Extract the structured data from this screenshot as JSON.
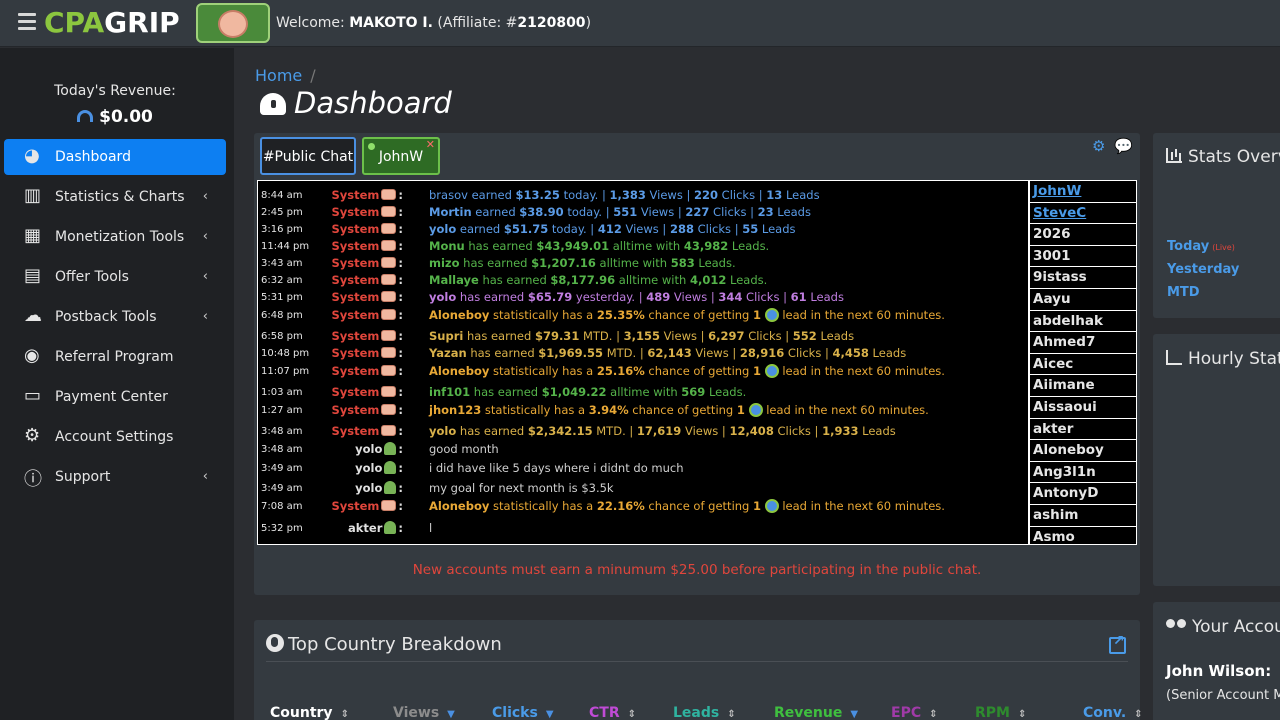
{
  "header": {
    "logo_cpa": "CPA",
    "logo_grip": "GRIP",
    "welcome_prefix": "Welcome: ",
    "user_name": "MAKOTO I.",
    "affiliate_prefix": " (Affiliate: #",
    "affiliate_id": "2120800",
    "affiliate_suffix": ")"
  },
  "sidebar": {
    "revenue_label": "Today's Revenue:",
    "revenue_value": "$0.00",
    "items": [
      {
        "label": "Dashboard",
        "icon": "gauge-icon",
        "active": true,
        "chevron": false
      },
      {
        "label": "Statistics & Charts",
        "icon": "bar-chart-icon",
        "chevron": true
      },
      {
        "label": "Monetization Tools",
        "icon": "grid-icon",
        "chevron": true
      },
      {
        "label": "Offer Tools",
        "icon": "clipboard-icon",
        "chevron": true
      },
      {
        "label": "Postback Tools",
        "icon": "cloud-icon",
        "chevron": true
      },
      {
        "label": "Referral Program",
        "icon": "coins-icon",
        "chevron": false
      },
      {
        "label": "Payment Center",
        "icon": "money-bill-icon",
        "chevron": false
      },
      {
        "label": "Account Settings",
        "icon": "gear-icon",
        "chevron": false
      },
      {
        "label": "Support",
        "icon": "info-icon",
        "chevron": true
      }
    ],
    "chevron_glyph": "‹"
  },
  "breadcrumb": {
    "home": "Home",
    "sep": "/"
  },
  "page_title": "Dashboard",
  "chat": {
    "tabs": {
      "public": "#Public Chat",
      "john": "JohnW"
    },
    "notice": "New accounts must earn a minumum $25.00 before participating in the public chat.",
    "messages": [
      {
        "time": "8:44 am",
        "user": "System",
        "parts": [
          [
            "blue",
            "brasov"
          ],
          [
            "blue",
            " earned "
          ],
          [
            "bblue",
            "$13.25"
          ],
          [
            "blue",
            " today. | "
          ],
          [
            "bblue",
            "1,383"
          ],
          [
            "blue",
            " Views | "
          ],
          [
            "bblue",
            "220"
          ],
          [
            "blue",
            " Clicks | "
          ],
          [
            "bblue",
            "13"
          ],
          [
            "blue",
            " Leads"
          ]
        ]
      },
      {
        "time": "2:45 pm",
        "user": "System",
        "parts": [
          [
            "bblue",
            "Mortin"
          ],
          [
            "blue",
            " earned "
          ],
          [
            "bblue",
            "$38.90"
          ],
          [
            "blue",
            " today. | "
          ],
          [
            "bblue",
            "551"
          ],
          [
            "blue",
            " Views | "
          ],
          [
            "bblue",
            "227"
          ],
          [
            "blue",
            " Clicks | "
          ],
          [
            "bblue",
            "23"
          ],
          [
            "blue",
            " Leads"
          ]
        ]
      },
      {
        "time": "3:16 pm",
        "user": "System",
        "parts": [
          [
            "bblue",
            "yolo"
          ],
          [
            "blue",
            " earned "
          ],
          [
            "bblue",
            "$51.75"
          ],
          [
            "blue",
            " today. | "
          ],
          [
            "bblue",
            "412"
          ],
          [
            "blue",
            " Views | "
          ],
          [
            "bblue",
            "288"
          ],
          [
            "blue",
            " Clicks | "
          ],
          [
            "bblue",
            "55"
          ],
          [
            "blue",
            " Leads"
          ]
        ]
      },
      {
        "time": "11:44 pm",
        "user": "System",
        "parts": [
          [
            "bgreen",
            "Monu"
          ],
          [
            "green",
            " has earned "
          ],
          [
            "bgreen",
            "$43,949.01"
          ],
          [
            "green",
            " alltime with "
          ],
          [
            "bgreen",
            "43,982"
          ],
          [
            "green",
            " Leads."
          ]
        ]
      },
      {
        "time": "3:43 am",
        "user": "System",
        "parts": [
          [
            "bgreen",
            "mizo"
          ],
          [
            "green",
            " has earned "
          ],
          [
            "bgreen",
            "$1,207.16"
          ],
          [
            "green",
            " alltime with "
          ],
          [
            "bgreen",
            "583"
          ],
          [
            "green",
            " Leads."
          ]
        ]
      },
      {
        "time": "6:32 am",
        "user": "System",
        "parts": [
          [
            "bgreen",
            "Mallaye"
          ],
          [
            "green",
            " has earned "
          ],
          [
            "bgreen",
            "$8,177.96"
          ],
          [
            "green",
            " alltime with "
          ],
          [
            "bgreen",
            "4,012"
          ],
          [
            "green",
            " Leads."
          ]
        ]
      },
      {
        "time": "5:31 pm",
        "user": "System",
        "parts": [
          [
            "bpurple",
            "yolo"
          ],
          [
            "purple",
            " has earned "
          ],
          [
            "bpurple",
            "$65.79"
          ],
          [
            "purple",
            " yesterday. | "
          ],
          [
            "bpurple",
            "489"
          ],
          [
            "purple",
            " Views | "
          ],
          [
            "bpurple",
            "344"
          ],
          [
            "purple",
            " Clicks | "
          ],
          [
            "bpurple",
            "61"
          ],
          [
            "purple",
            " Leads"
          ]
        ]
      },
      {
        "time": "6:48 pm",
        "user": "System",
        "parts": [
          [
            "bgold",
            "Aloneboy"
          ],
          [
            "gold",
            " statistically has a "
          ],
          [
            "bgold",
            "25.35%"
          ],
          [
            "gold",
            " chance of getting "
          ],
          [
            "bgold",
            "1"
          ],
          [
            "globe",
            ""
          ],
          [
            "gold",
            " lead in the next 60 minutes."
          ]
        ]
      },
      {
        "time": "6:58 pm",
        "user": "System",
        "parts": [
          [
            "btan",
            "Supri"
          ],
          [
            "tan",
            " has earned "
          ],
          [
            "btan",
            "$79.31"
          ],
          [
            "tan",
            " MTD. | "
          ],
          [
            "btan",
            "3,155"
          ],
          [
            "tan",
            " Views | "
          ],
          [
            "btan",
            "6,297"
          ],
          [
            "tan",
            " Clicks | "
          ],
          [
            "btan",
            "552"
          ],
          [
            "tan",
            " Leads"
          ]
        ]
      },
      {
        "time": "10:48 pm",
        "user": "System",
        "parts": [
          [
            "btan",
            "Yazan"
          ],
          [
            "tan",
            " has earned "
          ],
          [
            "btan",
            "$1,969.55"
          ],
          [
            "tan",
            " MTD. | "
          ],
          [
            "btan",
            "62,143"
          ],
          [
            "tan",
            " Views | "
          ],
          [
            "btan",
            "28,916"
          ],
          [
            "tan",
            " Clicks | "
          ],
          [
            "btan",
            "4,458"
          ],
          [
            "tan",
            " Leads"
          ]
        ]
      },
      {
        "time": "11:07 pm",
        "user": "System",
        "parts": [
          [
            "bgold",
            "Aloneboy"
          ],
          [
            "gold",
            " statistically has a "
          ],
          [
            "bgold",
            "25.16%"
          ],
          [
            "gold",
            " chance of getting "
          ],
          [
            "bgold",
            "1"
          ],
          [
            "globe",
            ""
          ],
          [
            "gold",
            " lead in the next 60 minutes."
          ]
        ]
      },
      {
        "time": "1:03 am",
        "user": "System",
        "parts": [
          [
            "bgreen",
            "inf101"
          ],
          [
            "green",
            " has earned "
          ],
          [
            "bgreen",
            "$1,049.22"
          ],
          [
            "green",
            " alltime with "
          ],
          [
            "bgreen",
            "569"
          ],
          [
            "green",
            " Leads."
          ]
        ]
      },
      {
        "time": "1:27 am",
        "user": "System",
        "parts": [
          [
            "bgold",
            "jhon123"
          ],
          [
            "gold",
            " statistically has a "
          ],
          [
            "bgold",
            "3.94%"
          ],
          [
            "gold",
            " chance of getting "
          ],
          [
            "bgold",
            "1"
          ],
          [
            "globe",
            ""
          ],
          [
            "gold",
            " lead in the next 60 minutes."
          ]
        ]
      },
      {
        "time": "3:48 am",
        "user": "System",
        "parts": [
          [
            "btan",
            "yolo"
          ],
          [
            "tan",
            " has earned "
          ],
          [
            "btan",
            "$2,342.15"
          ],
          [
            "tan",
            " MTD. | "
          ],
          [
            "btan",
            "17,619"
          ],
          [
            "tan",
            " Views | "
          ],
          [
            "btan",
            "12,408"
          ],
          [
            "tan",
            " Clicks | "
          ],
          [
            "btan",
            "1,933"
          ],
          [
            "tan",
            " Leads"
          ]
        ]
      },
      {
        "time": "3:48 am",
        "user": "yolo",
        "parts": [
          [
            "grey",
            "good month"
          ]
        ]
      },
      {
        "time": "3:49 am",
        "user": "yolo",
        "parts": [
          [
            "grey",
            "i did have like 5 days where i didnt do much"
          ]
        ]
      },
      {
        "time": "3:49 am",
        "user": "yolo",
        "parts": [
          [
            "grey",
            "my goal for next month is $3.5k"
          ]
        ]
      },
      {
        "time": "7:08 am",
        "user": "System",
        "parts": [
          [
            "bgold",
            "Aloneboy"
          ],
          [
            "gold",
            " statistically has a "
          ],
          [
            "bgold",
            "22.16%"
          ],
          [
            "gold",
            " chance of getting "
          ],
          [
            "bgold",
            "1"
          ],
          [
            "globe",
            ""
          ],
          [
            "gold",
            " lead in the next 60 minutes."
          ]
        ]
      },
      {
        "time": "5:32 pm",
        "user": "akter",
        "parts": [
          [
            "grey",
            "l"
          ]
        ]
      }
    ],
    "users": [
      {
        "name": "JohnW",
        "online": true
      },
      {
        "name": "SteveC",
        "online": true
      },
      {
        "name": "2026",
        "online": false
      },
      {
        "name": "3001",
        "online": false
      },
      {
        "name": "9istass",
        "online": false
      },
      {
        "name": "Aayu",
        "online": false
      },
      {
        "name": "abdelhak",
        "online": false
      },
      {
        "name": "Ahmed7",
        "online": false
      },
      {
        "name": "Aicec",
        "online": false
      },
      {
        "name": "Aiimane",
        "online": false
      },
      {
        "name": "Aissaoui",
        "online": false
      },
      {
        "name": "akter",
        "online": false
      },
      {
        "name": "Aloneboy",
        "online": false
      },
      {
        "name": "Ang3l1n",
        "online": false
      },
      {
        "name": "AntonyD",
        "online": false
      },
      {
        "name": "ashim",
        "online": false
      },
      {
        "name": "Asmo",
        "online": false
      }
    ]
  },
  "country": {
    "title": "Top Country Breakdown",
    "columns": [
      {
        "label": "Country",
        "color": "#ffffff",
        "sort": "both"
      },
      {
        "label": "Views",
        "color": "#8c8c8c",
        "sort": "down"
      },
      {
        "label": "Clicks",
        "color": "#4a9be8",
        "sort": "down"
      },
      {
        "label": "CTR",
        "color": "#c04bd6",
        "sort": "both"
      },
      {
        "label": "Leads",
        "color": "#2fb3a0",
        "sort": "both"
      },
      {
        "label": "Revenue",
        "color": "#3fbf3f",
        "sort": "down"
      },
      {
        "label": "EPC",
        "color": "#a03aa8",
        "sort": "both"
      },
      {
        "label": "RPM",
        "color": "#2e8b2e",
        "sort": "both"
      },
      {
        "label": "Conv.",
        "color": "#4a9be8",
        "sort": "both"
      }
    ]
  },
  "right": {
    "stats_title": "Stats Overview",
    "stats_links": [
      "Today",
      "Yesterday",
      "MTD"
    ],
    "live_label": "(Live)",
    "hourly_title": "Hourly Stats",
    "account_title": "Your Account Manager",
    "manager_name": "John Wilson:",
    "manager_role": "(Senior Account Manager)"
  },
  "colors": {
    "accent": "#0d7ff2",
    "link": "#4a9be8",
    "system_user": "#e0463c",
    "logo_green": "#8cc63f"
  }
}
